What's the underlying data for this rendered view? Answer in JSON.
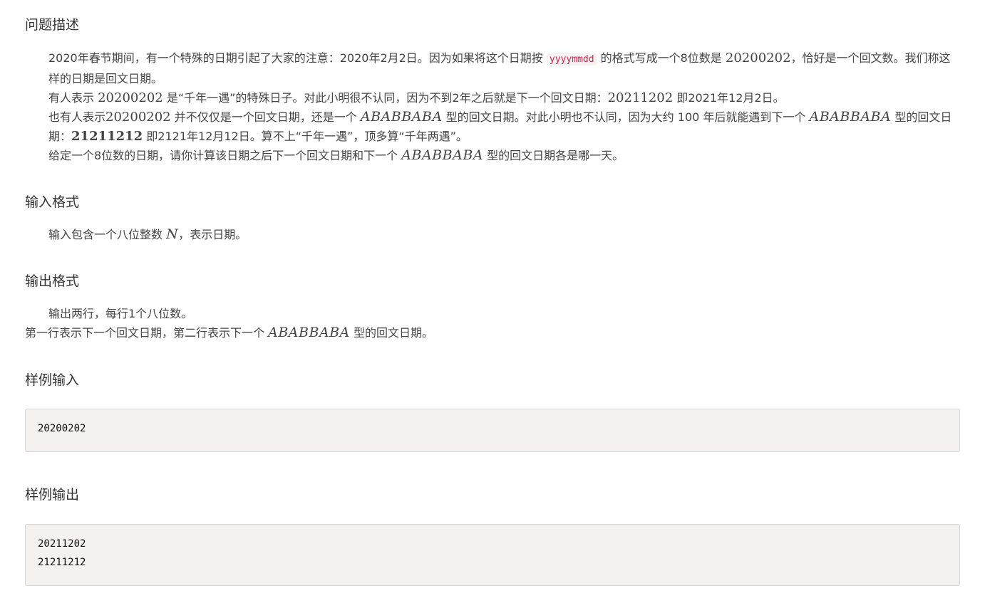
{
  "problem": {
    "heading": "问题描述",
    "p1": {
      "t1": "2020年春节期间，有一个特殊的日期引起了大家的注意：2020年2月2日。因为如果将这个日期按",
      "code": "yyyymmdd",
      "t2": "的格式写成一个8位数是",
      "num": "20200202",
      "t3": "，恰好是一个回文数。我们称这样的日期是回文日期。"
    },
    "p2": {
      "t1": "有人表示",
      "num1": "20200202",
      "t2": "是“千年一遇”的特殊日子。对此小明很不认同，因为不到2年之后就是下一个回文日期：",
      "num2": "20211202",
      "t3": "即2021年12月2日。"
    },
    "p3": {
      "t1": "也有人表示",
      "num1": "20200202",
      "t2": "并不仅仅是一个回文日期，还是一个",
      "pattern1": "ABABBABA",
      "t3": "型的回文日期。对此小明也不认同，因为大约 100 年后就能遇到下一个",
      "pattern2": "ABABBABA",
      "t4": "型的回文日期：",
      "num2": "21211212",
      "t5": "即2121年12月12日。算不上“千年一遇”，顶多算“千年两遇”。"
    },
    "p4": {
      "t1": "给定一个8位数的日期，请你计算该日期之后下一个回文日期和下一个",
      "pattern": "ABABBABA",
      "t2": "型的回文日期各是哪一天。"
    }
  },
  "input_format": {
    "heading": "输入格式",
    "t1": "输入包含一个八位整数",
    "var": "N",
    "t2": "，表示日期。"
  },
  "output_format": {
    "heading": "输出格式",
    "line1": "输出两行，每行1个八位数。",
    "line2_t1": "第一行表示下一个回文日期，第二行表示下一个",
    "pattern": "ABABBABA",
    "line2_t2": "型的回文日期。"
  },
  "sample_input": {
    "heading": "样例输入",
    "code": "20200202"
  },
  "sample_output": {
    "heading": "样例输出",
    "code": "20211202\n21211212"
  }
}
